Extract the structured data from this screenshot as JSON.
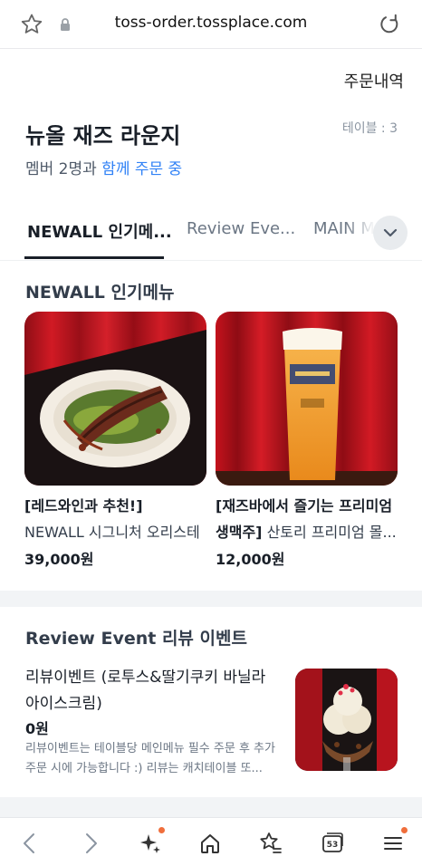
{
  "browser": {
    "url": "toss-order.tossplace.com",
    "tab_count": "53"
  },
  "header": {
    "order_history": "주문내역",
    "store_name": "뉴올 재즈 라운지",
    "table": "테이블 : 3",
    "members_prefix": "멤버 2명과 ",
    "members_highlight": "함께 주문 중"
  },
  "tabs": [
    {
      "label": "NEWALL 인기메..."
    },
    {
      "label": "Review Eve..."
    },
    {
      "label": "MAIN M"
    }
  ],
  "sections": {
    "popular": {
      "title": "NEWALL 인기메뉴",
      "items": [
        {
          "tag": "[레드와인과 추천!]",
          "name": " NEWALL 시그니처 오리스테이크 [...",
          "price": "39,000원",
          "image": "duck-steak-photo"
        },
        {
          "tag": "[재즈바에서 즐기는 프리미엄 생맥주]",
          "name": " 산토리 프리미엄 몰...",
          "price": "12,000원",
          "image": "draft-beer-photo"
        }
      ]
    },
    "review": {
      "title": "Review Event 리뷰 이벤트",
      "item": {
        "name": "리뷰이벤트 (로투스&딸기쿠키 바닐라 아이스크림)",
        "price": "0원",
        "description": "리뷰이벤트는 테이블당 메인메뉴 필수 주문 후 추가 주문 시에 가능합니다 :) 리뷰는 캐치테이블 또...",
        "image": "ice-cream-photo"
      }
    }
  },
  "icons": {
    "bookmark": "star-outline-icon",
    "lock": "lock-icon",
    "reload": "reload-icon",
    "more_tabs": "chevron-down-icon",
    "nav": [
      "back-arrow-icon",
      "forward-arrow-icon",
      "sparkle-icon",
      "home-icon",
      "star-list-icon",
      "tabs-icon",
      "menu-icon"
    ]
  },
  "colors": {
    "accent": "#3182f6",
    "badge_dot": "#f06e3c",
    "curtain_red": "#c8102e"
  }
}
